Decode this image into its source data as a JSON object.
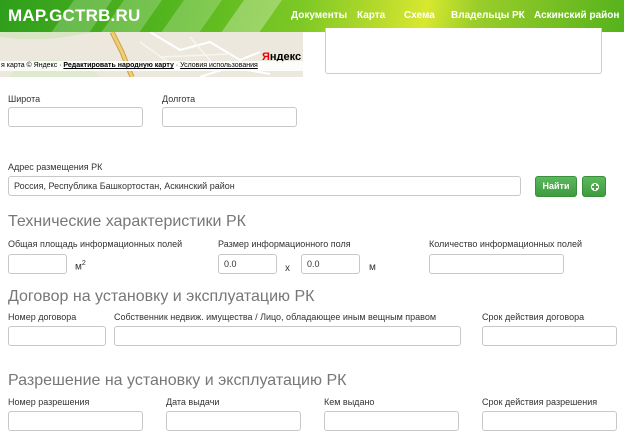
{
  "header": {
    "logo": "MAP.GCTRB.RU",
    "nav": [
      "Документы",
      "Карта",
      "Схема",
      "Владельцы РК",
      "Аскинский район"
    ]
  },
  "map": {
    "brand_first": "Я",
    "brand_rest": "ндекс",
    "footer_prefix": "я карта © Яндекс · ",
    "footer_edit": "Редактировать народную карту",
    "footer_sep": " · ",
    "footer_terms": "Условия использования"
  },
  "coords": {
    "lat_label": "Широта",
    "lat_value": "",
    "lon_label": "Долгота",
    "lon_value": ""
  },
  "address": {
    "label": "Адрес размещения РК",
    "value": "Россия, Республика Башкортостан, Аскинский район",
    "find_button": "Найти"
  },
  "tech": {
    "title": "Технические характеристики РК",
    "area_label": "Общая площадь информационных полей",
    "area_value": "",
    "area_unit": "м",
    "area_unit_sup": "2",
    "size_label": "Размер информационного поля",
    "size_w": "0.0",
    "size_x": "х",
    "size_h": "0.0",
    "size_unit": "м",
    "count_label": "Количество информационных полей",
    "count_value": ""
  },
  "contract": {
    "title": "Договор на установку и эксплуатацию РК",
    "number_label": "Номер договора",
    "owner_label": "Собственник недвиж. имущества / Лицо, обладающее иным вещным правом",
    "term_label": "Срок действия договора"
  },
  "permit": {
    "title": "Разрешение на установку и эксплуатацию РК",
    "number_label": "Номер разрешения",
    "date_label": "Дата выдачи",
    "issuer_label": "Кем выдано",
    "term_label": "Срок действия разрешения"
  },
  "colors": {
    "header_green": "#58b81f",
    "header_yellow": "#d8e82f",
    "button_green": "#4cae4c"
  }
}
